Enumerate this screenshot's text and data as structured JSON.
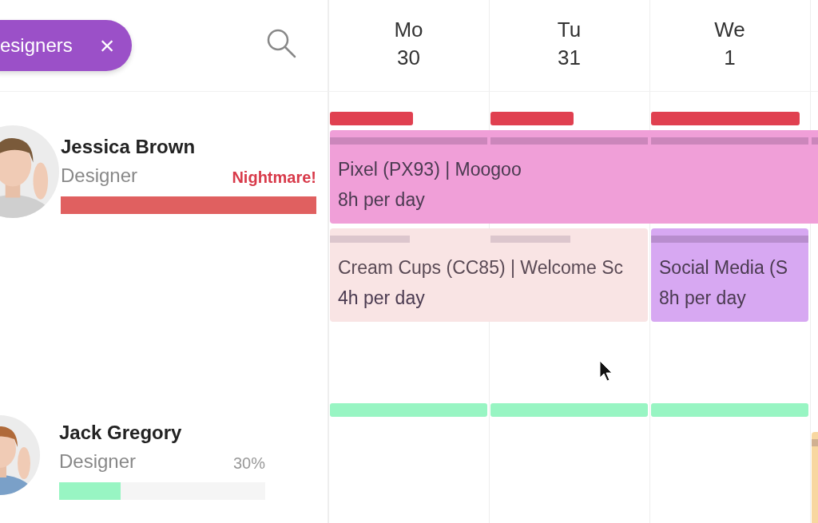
{
  "filter_chip": {
    "label": "esigners",
    "close": "×"
  },
  "days": [
    {
      "weekday": "Mo",
      "date": "30"
    },
    {
      "weekday": "Tu",
      "date": "31"
    },
    {
      "weekday": "We",
      "date": "1"
    }
  ],
  "people": [
    {
      "name": "Jessica Brown",
      "role": "Designer",
      "status": "Nightmare!",
      "kind": "alert",
      "level": 1,
      "color": "#e06060",
      "capacity": [
        {
          "kind": "half",
          "color": "#e04050"
        },
        {
          "kind": "half",
          "color": "#e04050"
        },
        {
          "kind": "most",
          "color": "#e04050"
        }
      ],
      "lanes": [
        [
          {
            "title": "Pixel (PX93) | Moogoo",
            "hours": "8h per day",
            "kind": "confirmed",
            "color": "#f09fd8",
            "days": [
              true,
              true,
              true,
              true
            ]
          }
        ],
        [
          {
            "title": "Cream Cups (CC85) | Welcome Sc",
            "hours": "4h per day",
            "kind": "tentative",
            "color": "#f9e4e4",
            "days": [
              true,
              true,
              false,
              false
            ]
          },
          {
            "title": "Social Media (S",
            "hours": "8h per day",
            "kind": "confirmed",
            "color": "#d7a8f2",
            "days": [
              false,
              false,
              true,
              false
            ]
          }
        ]
      ]
    },
    {
      "name": "Jack Gregory",
      "role": "Designer",
      "status": "30%",
      "kind": "percent",
      "level": 0.3,
      "color": "#98f5c3",
      "capacity": [
        {
          "kind": "full",
          "color": "#98f5c3"
        },
        {
          "kind": "full",
          "color": "#98f5c3"
        },
        {
          "kind": "full",
          "color": "#98f5c3"
        }
      ],
      "lanes": [
        [
          {
            "kind": "confirmed",
            "color": "#f8d7a0",
            "days": [
              false,
              false,
              false,
              true
            ]
          }
        ]
      ]
    }
  ]
}
